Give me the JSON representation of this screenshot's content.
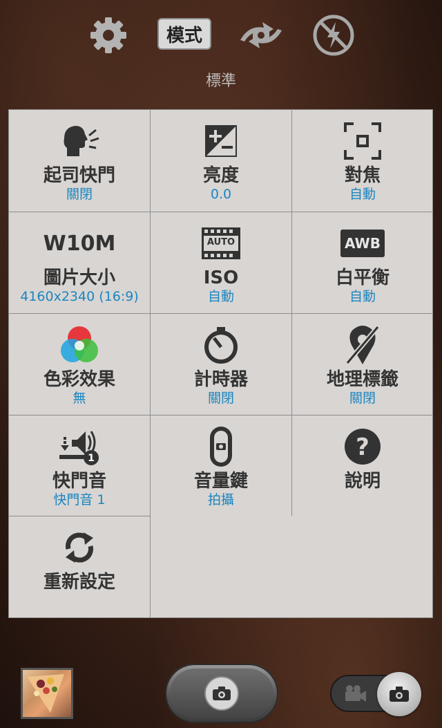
{
  "topbar": {
    "settings_icon": "gear-icon",
    "mode_label": "模式",
    "switch_camera_icon": "switch-camera-icon",
    "flash_icon": "flash-off-icon",
    "current_mode": "標準"
  },
  "settings": [
    {
      "icon": "cheese-shutter-icon",
      "label": "起司快門",
      "value": "關閉"
    },
    {
      "icon": "brightness-icon",
      "label": "亮度",
      "value": "0.0"
    },
    {
      "icon": "focus-icon",
      "label": "對焦",
      "value": "自動"
    },
    {
      "icon": "picture-size-icon",
      "icon_text": "W10M",
      "label": "圖片大小",
      "value": "4160x2340 (16:9)"
    },
    {
      "icon": "iso-icon",
      "icon_text": "AUTO",
      "label": "ISO",
      "value": "自動"
    },
    {
      "icon": "white-balance-icon",
      "icon_text": "AWB",
      "label": "白平衡",
      "value": "自動"
    },
    {
      "icon": "color-effect-icon",
      "label": "色彩效果",
      "value": "無"
    },
    {
      "icon": "timer-icon",
      "label": "計時器",
      "value": "關閉"
    },
    {
      "icon": "geotag-off-icon",
      "label": "地理標籤",
      "value": "關閉"
    },
    {
      "icon": "shutter-sound-icon",
      "label": "快門音",
      "value": "快門音 1"
    },
    {
      "icon": "volume-key-icon",
      "label": "音量鍵",
      "value": "拍攝"
    },
    {
      "icon": "help-icon",
      "label": "說明",
      "value": ""
    },
    {
      "icon": "reset-icon",
      "label": "重新設定",
      "value": ""
    }
  ],
  "bottombar": {
    "thumbnail": "gallery-thumbnail",
    "shutter_icon": "camera-icon",
    "toggle_video_icon": "video-camera-icon",
    "toggle_photo_icon": "camera-icon"
  },
  "colors": {
    "grid_bg": "#d8d5d3",
    "value_text": "#1b86c0",
    "label_text": "#333333"
  }
}
